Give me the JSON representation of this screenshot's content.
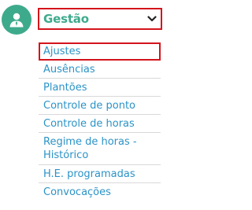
{
  "section": {
    "title": "Gestão",
    "icon": "user-avatar-icon",
    "expanded": true
  },
  "items": [
    {
      "label": "Ajustes",
      "selected": true
    },
    {
      "label": "Ausências"
    },
    {
      "label": "Plantões"
    },
    {
      "label": "Controle de ponto"
    },
    {
      "label": "Controle de horas"
    },
    {
      "label": "Regime de horas - Histórico"
    },
    {
      "label": "H.E. programadas"
    },
    {
      "label": "Convocações"
    }
  ],
  "colors": {
    "accent": "#3eaa8c",
    "link": "#2b93c7",
    "highlight_border": "#d4141c"
  }
}
